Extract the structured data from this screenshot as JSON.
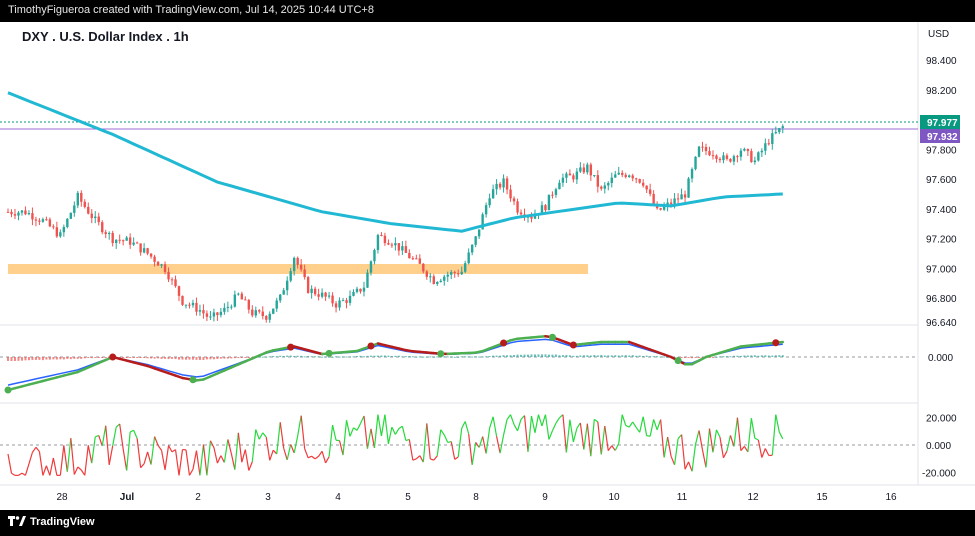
{
  "credit_line": "TimothyFigueroa created with TradingView.com, Jul 14, 2025 10:44 UTC+8",
  "symbol_title": "DXY . U.S. Dollar Index . 1h",
  "currency": "USD",
  "branding": "TradingView",
  "price_axis": {
    "ticks": [
      "98.400",
      "98.200",
      "98.000",
      "97.800",
      "97.600",
      "97.400",
      "97.200",
      "97.000",
      "96.800",
      "96.640"
    ],
    "last_price_label": "97.977",
    "line_label": "97.932"
  },
  "osc1_axis": {
    "ticks": [
      "0.000"
    ]
  },
  "osc2_axis": {
    "ticks": [
      "20.000",
      "0.000",
      "-20.000"
    ]
  },
  "time_axis": {
    "ticks": [
      "28",
      "Jul",
      "2",
      "3",
      "4",
      "5",
      "8",
      "9",
      "10",
      "11",
      "12",
      "15",
      "16"
    ]
  },
  "colors": {
    "up": "#26a69a",
    "down": "#ef5350",
    "ma": "#21b8d4",
    "zone": "#ffc778",
    "last_price": "#089981",
    "line_label": "#7e57c2"
  },
  "chart_data": {
    "type": "candlestick",
    "title": "DXY . U.S. Dollar Index . 1h",
    "ylim": [
      96.64,
      98.5
    ],
    "close_path_approx": [
      [
        0,
        97.38
      ],
      [
        5,
        97.38
      ],
      [
        10,
        97.32
      ],
      [
        15,
        97.22
      ],
      [
        20,
        97.48
      ],
      [
        25,
        97.32
      ],
      [
        30,
        97.2
      ],
      [
        35,
        97.18
      ],
      [
        40,
        97.1
      ],
      [
        45,
        97.0
      ],
      [
        50,
        96.78
      ],
      [
        55,
        96.72
      ],
      [
        58,
        96.66
      ],
      [
        62,
        96.72
      ],
      [
        66,
        96.82
      ],
      [
        70,
        96.7
      ],
      [
        74,
        96.68
      ],
      [
        78,
        96.8
      ],
      [
        82,
        97.08
      ],
      [
        86,
        96.86
      ],
      [
        90,
        96.82
      ],
      [
        94,
        96.76
      ],
      [
        98,
        96.8
      ],
      [
        102,
        96.88
      ],
      [
        106,
        97.22
      ],
      [
        110,
        97.18
      ],
      [
        114,
        97.1
      ],
      [
        118,
        97.02
      ],
      [
        122,
        96.92
      ],
      [
        126,
        96.96
      ],
      [
        130,
        96.98
      ],
      [
        134,
        97.2
      ],
      [
        138,
        97.5
      ],
      [
        142,
        97.58
      ],
      [
        146,
        97.4
      ],
      [
        150,
        97.35
      ],
      [
        154,
        97.42
      ],
      [
        158,
        97.6
      ],
      [
        162,
        97.62
      ],
      [
        166,
        97.68
      ],
      [
        170,
        97.52
      ],
      [
        174,
        97.62
      ],
      [
        178,
        97.64
      ],
      [
        182,
        97.58
      ],
      [
        186,
        97.38
      ],
      [
        190,
        97.44
      ],
      [
        194,
        97.5
      ],
      [
        198,
        97.8
      ],
      [
        202,
        97.78
      ],
      [
        206,
        97.72
      ],
      [
        210,
        97.8
      ],
      [
        214,
        97.72
      ],
      [
        218,
        97.86
      ],
      [
        222,
        97.95
      ]
    ],
    "ma_path_approx": [
      [
        0,
        98.18
      ],
      [
        30,
        97.9
      ],
      [
        60,
        97.58
      ],
      [
        90,
        97.38
      ],
      [
        110,
        97.3
      ],
      [
        130,
        97.25
      ],
      [
        145,
        97.34
      ],
      [
        160,
        97.39
      ],
      [
        175,
        97.44
      ],
      [
        190,
        97.42
      ],
      [
        205,
        97.48
      ],
      [
        222,
        97.5
      ]
    ],
    "horizontal_zone": [
      96.96,
      97.04
    ],
    "last_price": 97.977,
    "line_price": 97.932
  }
}
